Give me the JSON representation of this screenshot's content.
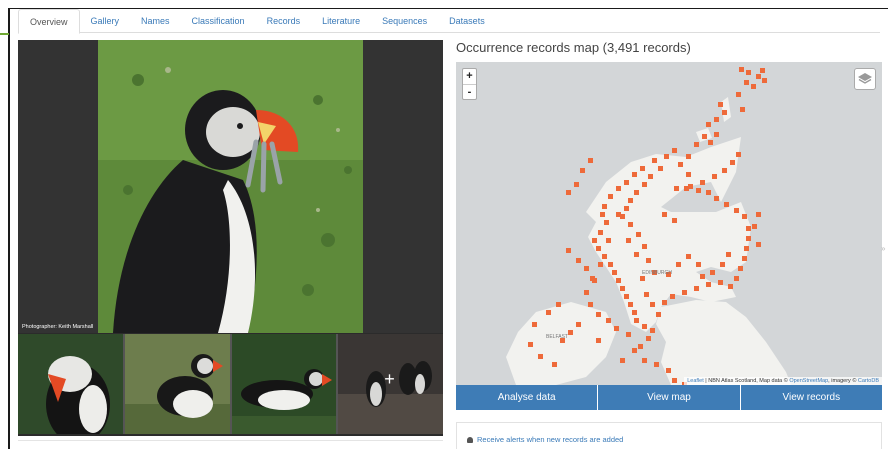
{
  "tabs": [
    {
      "label": "Overview",
      "active": true
    },
    {
      "label": "Gallery"
    },
    {
      "label": "Names"
    },
    {
      "label": "Classification"
    },
    {
      "label": "Records"
    },
    {
      "label": "Literature"
    },
    {
      "label": "Sequences"
    },
    {
      "label": "Datasets"
    }
  ],
  "gallery": {
    "photo_credit": "Photographer: Keith Marshall",
    "more_icon": "plus-icon"
  },
  "map": {
    "title": "Occurrence records map (3,491 records)",
    "zoom_in": "+",
    "zoom_out": "-",
    "city_label": "EDINBURGH",
    "city_label_2": "BELFAST",
    "attribution": {
      "leaflet": "Leaflet",
      "text": " | NBN Atlas Scotland, Map data © ",
      "osm": "OpenStreetMap",
      "imagery": ", imagery © ",
      "carto": "CartoDB"
    },
    "record_color": "#ee6a3a"
  },
  "actions": {
    "analyse": "Analyse data",
    "view_map": "View map",
    "view_records": "View records"
  },
  "alerts": {
    "label": "Receive alerts when new records are added",
    "icon": "bell-icon"
  }
}
